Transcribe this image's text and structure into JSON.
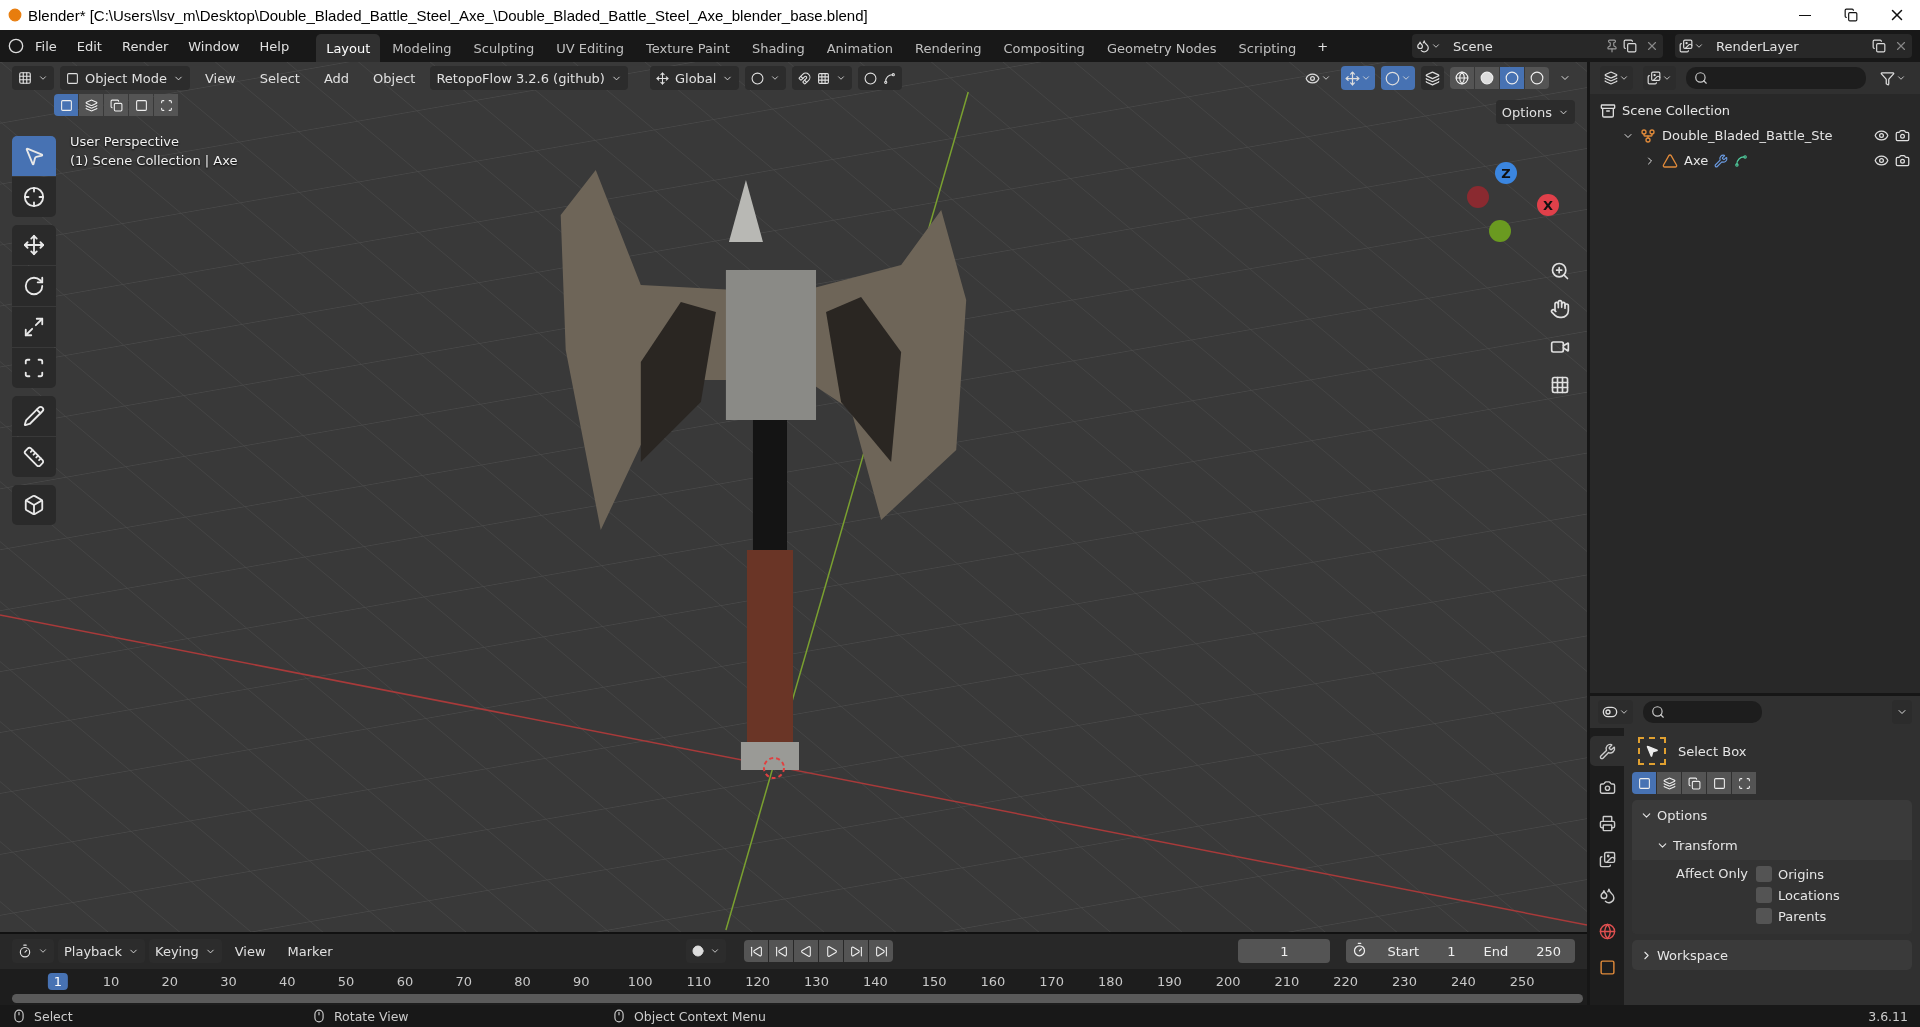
{
  "window": {
    "title": "Blender* [C:\\Users\\lsv_m\\Desktop\\Double_Bladed_Battle_Steel_Axe_\\Double_Bladed_Battle_Steel_Axe_blender_base.blend]"
  },
  "menu": [
    "File",
    "Edit",
    "Render",
    "Window",
    "Help"
  ],
  "workspaces": [
    {
      "label": "Layout",
      "selected": true
    },
    {
      "label": "Modeling",
      "selected": false
    },
    {
      "label": "Sculpting",
      "selected": false
    },
    {
      "label": "UV Editing",
      "selected": false
    },
    {
      "label": "Texture Paint",
      "selected": false
    },
    {
      "label": "Shading",
      "selected": false
    },
    {
      "label": "Animation",
      "selected": false
    },
    {
      "label": "Rendering",
      "selected": false
    },
    {
      "label": "Compositing",
      "selected": false
    },
    {
      "label": "Geometry Nodes",
      "selected": false
    },
    {
      "label": "Scripting",
      "selected": false
    }
  ],
  "add_workspace": "+",
  "scene": "Scene",
  "view_layer": "RenderLayer",
  "viewport_header": {
    "mode": "Object Mode",
    "menus": [
      "View",
      "Select",
      "Add",
      "Object"
    ],
    "addon": "RetopoFlow 3.2.6 (github)",
    "orientation": "Global",
    "gizmos_on": true,
    "overlays_on": true,
    "xray": false,
    "shading": [
      {
        "kind": "wireframe",
        "selected": false
      },
      {
        "kind": "solid",
        "selected": false
      },
      {
        "kind": "material",
        "selected": true
      },
      {
        "kind": "rendered",
        "selected": false
      }
    ],
    "options": "Options"
  },
  "select_modes": [
    {
      "selected": true
    },
    {
      "selected": false
    },
    {
      "selected": false
    },
    {
      "selected": false
    },
    {
      "selected": false
    }
  ],
  "tools": [
    {
      "kind": "select",
      "selected": true
    },
    {
      "kind": "cursor",
      "selected": false
    },
    {
      "kind": "move",
      "selected": false
    },
    {
      "kind": "rotate",
      "selected": false
    },
    {
      "kind": "scale",
      "selected": false
    },
    {
      "kind": "transform",
      "selected": false
    },
    {
      "kind": "annotate",
      "selected": false
    },
    {
      "kind": "measure",
      "selected": false
    },
    {
      "kind": "add-cube",
      "selected": false
    }
  ],
  "viewport_info": [
    "User Perspective",
    "(1) Scene Collection | Axe"
  ],
  "gizmo": {
    "z": "Z",
    "x": "X"
  },
  "outliner": {
    "items": [
      {
        "label": "Scene Collection",
        "kind": "scene",
        "children": [
          {
            "label": "Double_Bladed_Battle_Ste",
            "kind": "collection",
            "expanded": true,
            "children": [
              {
                "label": "Axe",
                "kind": "object",
                "expanded": false
              }
            ]
          }
        ]
      }
    ]
  },
  "properties": {
    "tabs": [
      {
        "kind": "tool",
        "selected": true
      },
      {
        "kind": "render",
        "selected": false
      },
      {
        "kind": "output",
        "selected": false
      },
      {
        "kind": "view_layer",
        "selected": false
      },
      {
        "kind": "scene",
        "selected": false
      },
      {
        "kind": "world",
        "selected": false
      },
      {
        "kind": "object",
        "selected": false
      }
    ],
    "tool": "Select Box",
    "select_modes": [
      {
        "selected": true
      },
      {
        "selected": false
      },
      {
        "selected": false
      },
      {
        "selected": false
      },
      {
        "selected": false
      }
    ],
    "panels": [
      {
        "label": "Options",
        "expanded": true,
        "children": [
          {
            "label": "Transform",
            "expanded": true
          }
        ]
      },
      {
        "label": "Workspace",
        "expanded": false
      }
    ],
    "affect_only": {
      "label": "Affect Only",
      "options": [
        {
          "label": "Origins",
          "checked": false
        },
        {
          "label": "Locations",
          "checked": false
        },
        {
          "label": "Parents",
          "checked": false
        }
      ]
    }
  },
  "timeline": {
    "menus": [
      "Playback",
      "Keying",
      "View",
      "Marker"
    ],
    "current_frame": "1",
    "start_label": "Start",
    "start": "1",
    "end_label": "End",
    "end": "250",
    "ruler": [
      {
        "label": "1",
        "selected": true
      },
      {
        "label": "10",
        "selected": false
      },
      {
        "label": "20",
        "selected": false
      },
      {
        "label": "30",
        "selected": false
      },
      {
        "label": "40",
        "selected": false
      },
      {
        "label": "50",
        "selected": false
      },
      {
        "label": "60",
        "selected": false
      },
      {
        "label": "70",
        "selected": false
      },
      {
        "label": "80",
        "selected": false
      },
      {
        "label": "90",
        "selected": false
      },
      {
        "label": "100",
        "selected": false
      },
      {
        "label": "110",
        "selected": false
      },
      {
        "label": "120",
        "selected": false
      },
      {
        "label": "130",
        "selected": false
      },
      {
        "label": "140",
        "selected": false
      },
      {
        "label": "150",
        "selected": false
      },
      {
        "label": "160",
        "selected": false
      },
      {
        "label": "170",
        "selected": false
      },
      {
        "label": "180",
        "selected": false
      },
      {
        "label": "190",
        "selected": false
      },
      {
        "label": "200",
        "selected": false
      },
      {
        "label": "210",
        "selected": false
      },
      {
        "label": "220",
        "selected": false
      },
      {
        "label": "230",
        "selected": false
      },
      {
        "label": "240",
        "selected": false
      },
      {
        "label": "250",
        "selected": false
      }
    ]
  },
  "status_bar": {
    "hints": [
      "Select",
      "Rotate View",
      "Object Context Menu"
    ],
    "version": "3.6.11"
  }
}
